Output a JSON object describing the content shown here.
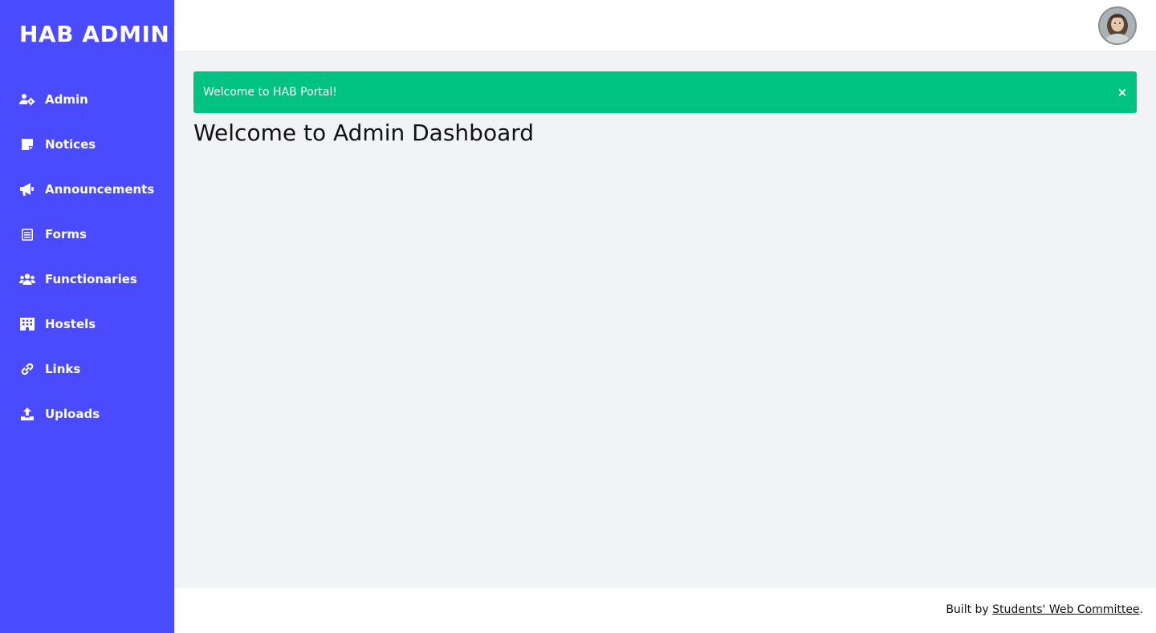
{
  "sidebar": {
    "brand": "HAB ADMIN",
    "items": [
      {
        "label": "Admin",
        "icon": "users-cog-icon"
      },
      {
        "label": "Notices",
        "icon": "sticky-note-icon"
      },
      {
        "label": "Announcements",
        "icon": "bullhorn-icon"
      },
      {
        "label": "Forms",
        "icon": "form-icon"
      },
      {
        "label": "Functionaries",
        "icon": "users-icon"
      },
      {
        "label": "Hostels",
        "icon": "building-icon"
      },
      {
        "label": "Links",
        "icon": "link-icon"
      },
      {
        "label": "Uploads",
        "icon": "upload-icon"
      }
    ]
  },
  "alert": {
    "text": "Welcome to HAB Portal!",
    "close": "×"
  },
  "main": {
    "title": "Welcome to Admin Dashboard"
  },
  "footer": {
    "prefix": "Built by ",
    "link": "Students' Web Committee",
    "suffix": "."
  },
  "colors": {
    "sidebar": "#4a4bfe",
    "alert": "#00c281",
    "background": "#f2f3f5"
  }
}
